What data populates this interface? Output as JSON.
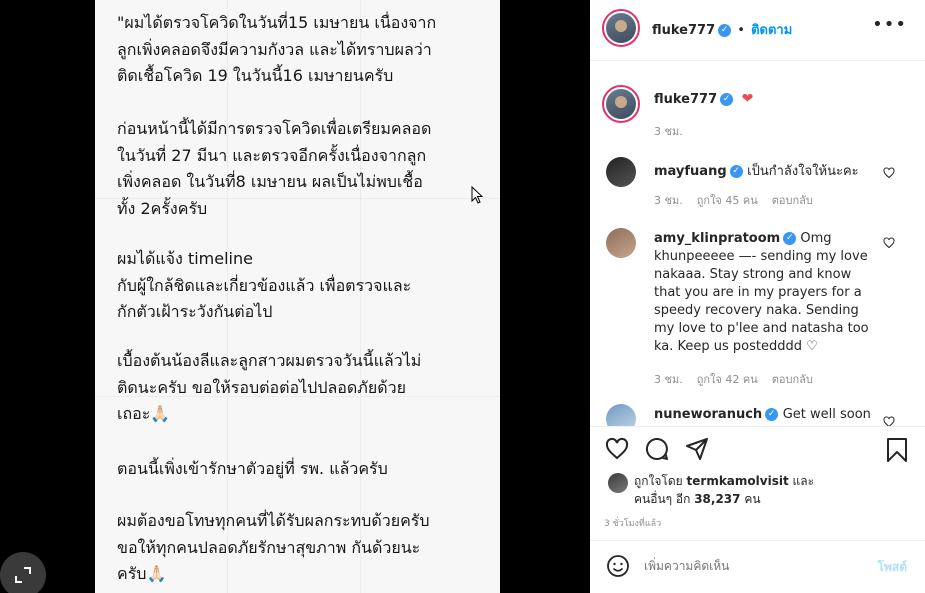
{
  "post_image": {
    "paragraphs": [
      "\"ผมได้ตรวจโควิดในวันที่15 เมษายน เนื่องจาก\nลูกเพิ่งคลอดจึงมีความกังวล และได้ทราบผลว่า\nติดเชื้อโควิด 19 ในวันนี้16 เมษายนครับ",
      "ก่อนหน้านี้ได้มีการตรวจโควิดเพื่อเตรียมคลอด\nในวันที่ 27 มีนา และตรวจอีกครั้งเนื่องจากลูก\nเพิ่งคลอด ในวันที่8 เมษายน ผลเป็นไม่พบเชื้อ\nทั้ง 2ครั้งครับ",
      "ผมได้แจ้ง timeline\nกับผู้ใกล้ชิดและเกี่ยวข้องแล้ว เพื่อตรวจและ\nกักตัวเฝ้าระวังกันต่อไป",
      "เบื้องต้นน้องลีและลูกสาวผมตรวจวันนี้แล้วไม่\nติดนะครับ ขอให้รอบต่อต่อไปปลอดภัยด้วย\nเถอะ🙏🏻",
      "ตอนนี้เพิ่งเข้ารักษาตัวอยู่ที่ รพ. แล้วครับ",
      "ผมต้องขอโทษทุกคนที่ได้รับผลกระทบด้วยครับ\nขอให้ทุกคนปลอดภัยรักษาสุขภาพ กันด้วยนะ\nครับ🙏🏻"
    ]
  },
  "header": {
    "username": "fluke777",
    "separator": "•",
    "follow_label": "ติดตาม",
    "more_icon": "more-horizontal-icon"
  },
  "caption": {
    "username": "fluke777",
    "emoji": "❤",
    "time": "3 ชม."
  },
  "comments": [
    {
      "username": "mayfuang",
      "text": "เป็นกำลังใจให้นะคะ",
      "time": "3 ชม.",
      "likes": "ถูกใจ 45 คน",
      "reply": "ตอบกลับ"
    },
    {
      "username": "amy_klinpratoom",
      "text_lines": [
        "Omg",
        "khunpeeeee —- sending my love",
        "nakaaa. Stay strong and know",
        "that you are in my prayers for a",
        "speedy recovery naka. Sending",
        "my love to p'lee and natasha too",
        "ka. Keep us postedddd ♡"
      ],
      "time": "3 ชม.",
      "likes": "ถูกใจ 42 คน",
      "reply": "ตอบกลับ"
    },
    {
      "username": "nuneworanuch",
      "text": "Get well soon"
    }
  ],
  "actions": {
    "like_icon": "heart-outline-icon",
    "comment_icon": "comment-icon",
    "share_icon": "send-icon",
    "save_icon": "bookmark-icon"
  },
  "likes": {
    "prefix": "ถูกใจโดย",
    "user": "termkamolvisit",
    "and": "และ",
    "others_prefix": "คนอื่นๆ อีก",
    "count": "38,237",
    "suffix": "คน"
  },
  "posted_time": "3 ชั่วโมงที่แล้ว",
  "add_comment": {
    "emoji_icon": "smiley-icon",
    "placeholder": "เพิ่มความคิดเห็น",
    "post_label": "โพสต์"
  },
  "colors": {
    "link_blue": "#0095f6",
    "verified_blue": "#3897f0",
    "heart_red": "#ed4956",
    "story_ring": "#e1306c"
  }
}
